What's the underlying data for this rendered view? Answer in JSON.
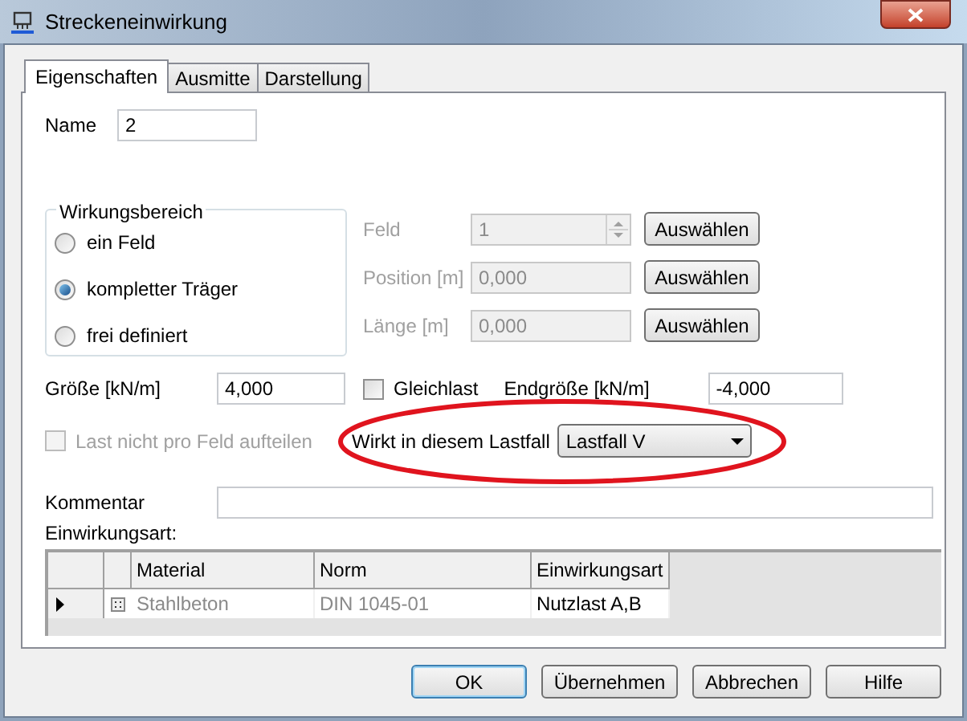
{
  "window": {
    "title": "Streckeneinwirkung"
  },
  "tabs": [
    {
      "label": "Eigenschaften",
      "selected": true
    },
    {
      "label": "Ausmitte",
      "selected": false
    },
    {
      "label": "Darstellung",
      "selected": false
    }
  ],
  "name": {
    "label": "Name",
    "value": "2"
  },
  "scope": {
    "title": "Wirkungsbereich",
    "options": [
      {
        "label": "ein Feld",
        "selected": false
      },
      {
        "label": "kompletter Träger",
        "selected": true
      },
      {
        "label": "frei definiert",
        "selected": false
      }
    ]
  },
  "range_fields": [
    {
      "kind": "spin",
      "label": "Feld",
      "value": "1",
      "disabled": true,
      "button": "Auswählen"
    },
    {
      "kind": "text",
      "label": "Position [m]",
      "value": "0,000",
      "disabled": true,
      "button": "Auswählen"
    },
    {
      "kind": "text",
      "label": "Länge [m]",
      "value": "0,000",
      "disabled": true,
      "button": "Auswählen"
    }
  ],
  "size": {
    "label": "Größe [kN/m]",
    "value": "4,000"
  },
  "uniform": {
    "label": "Gleichlast",
    "checked": false
  },
  "end_size": {
    "label": "Endgröße [kN/m]",
    "value": "-4,000"
  },
  "split": {
    "label": "Last nicht pro Feld aufteilen",
    "checked": false,
    "disabled": true
  },
  "load_case": {
    "label": "Wirkt in diesem Lastfall",
    "value": "Lastfall V"
  },
  "comment": {
    "label": "Kommentar"
  },
  "grid": {
    "label": "Einwirkungsart:",
    "columns": [
      "Material",
      "Norm",
      "Einwirkungsart"
    ],
    "rows": [
      {
        "current": true,
        "cells": [
          {
            "text": "Stahlbeton",
            "disabled": true
          },
          {
            "text": "DIN 1045-01",
            "disabled": true
          },
          {
            "text": "Nutzlast A,B",
            "disabled": false
          }
        ]
      }
    ]
  },
  "buttons": [
    {
      "label": "OK",
      "default": true
    },
    {
      "label": "Übernehmen",
      "default": false
    },
    {
      "label": "Abbrechen",
      "default": false
    },
    {
      "label": "Hilfe",
      "default": false
    }
  ],
  "annotations": [
    {
      "kind": "ellipse"
    }
  ]
}
